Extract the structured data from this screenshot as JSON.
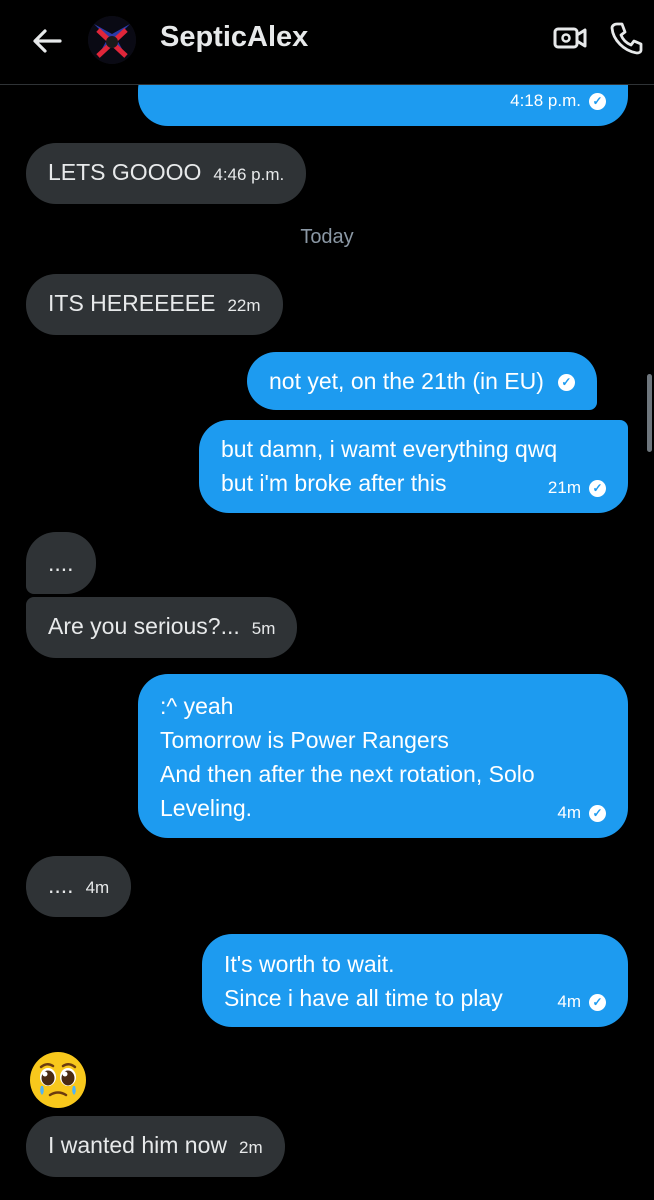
{
  "header": {
    "title": "SepticAlex",
    "icons": [
      "back-arrow-icon",
      "video-call-icon",
      "phone-icon"
    ]
  },
  "day_separator": "Today",
  "messages": [
    {
      "id": "m0",
      "side": "out",
      "lines": [
        ""
      ],
      "time": "4:18 p.m.",
      "read": true
    },
    {
      "id": "m1",
      "side": "in",
      "lines": [
        "LETS GOOOO"
      ],
      "time": "4:46 p.m."
    },
    {
      "id": "m2",
      "side": "in",
      "lines": [
        "ITS HEREEEEE"
      ],
      "time": "22m"
    },
    {
      "id": "m3",
      "side": "out",
      "lines": [
        "not yet, on the 21th (in EU)"
      ],
      "time": "",
      "read": true
    },
    {
      "id": "m4",
      "side": "out",
      "lines": [
        "but damn, i wamt everything qwq",
        "but i'm broke after this"
      ],
      "time": "21m",
      "read": true
    },
    {
      "id": "m5",
      "side": "in",
      "lines": [
        "...."
      ],
      "time": ""
    },
    {
      "id": "m6",
      "side": "in",
      "lines": [
        "Are you serious?..."
      ],
      "time": "5m"
    },
    {
      "id": "m7",
      "side": "out",
      "lines": [
        ":^ yeah",
        "Tomorrow is Power Rangers",
        "And then after the next rotation, Solo",
        "Leveling."
      ],
      "time": "4m",
      "read": true
    },
    {
      "id": "m8",
      "side": "in",
      "lines": [
        "...."
      ],
      "time": "4m"
    },
    {
      "id": "m9",
      "side": "out",
      "lines": [
        "It's worth to wait.",
        "Since i have all time to play"
      ],
      "time": "4m",
      "read": true
    },
    {
      "id": "m10",
      "side": "in",
      "emoji": "pleading-face-emoji"
    },
    {
      "id": "m11",
      "side": "in",
      "lines": [
        "I wanted him now"
      ],
      "time": "2m"
    }
  ],
  "colors": {
    "outgoing": "#1d9bf0",
    "incoming": "#2f3336",
    "background": "#000000"
  }
}
